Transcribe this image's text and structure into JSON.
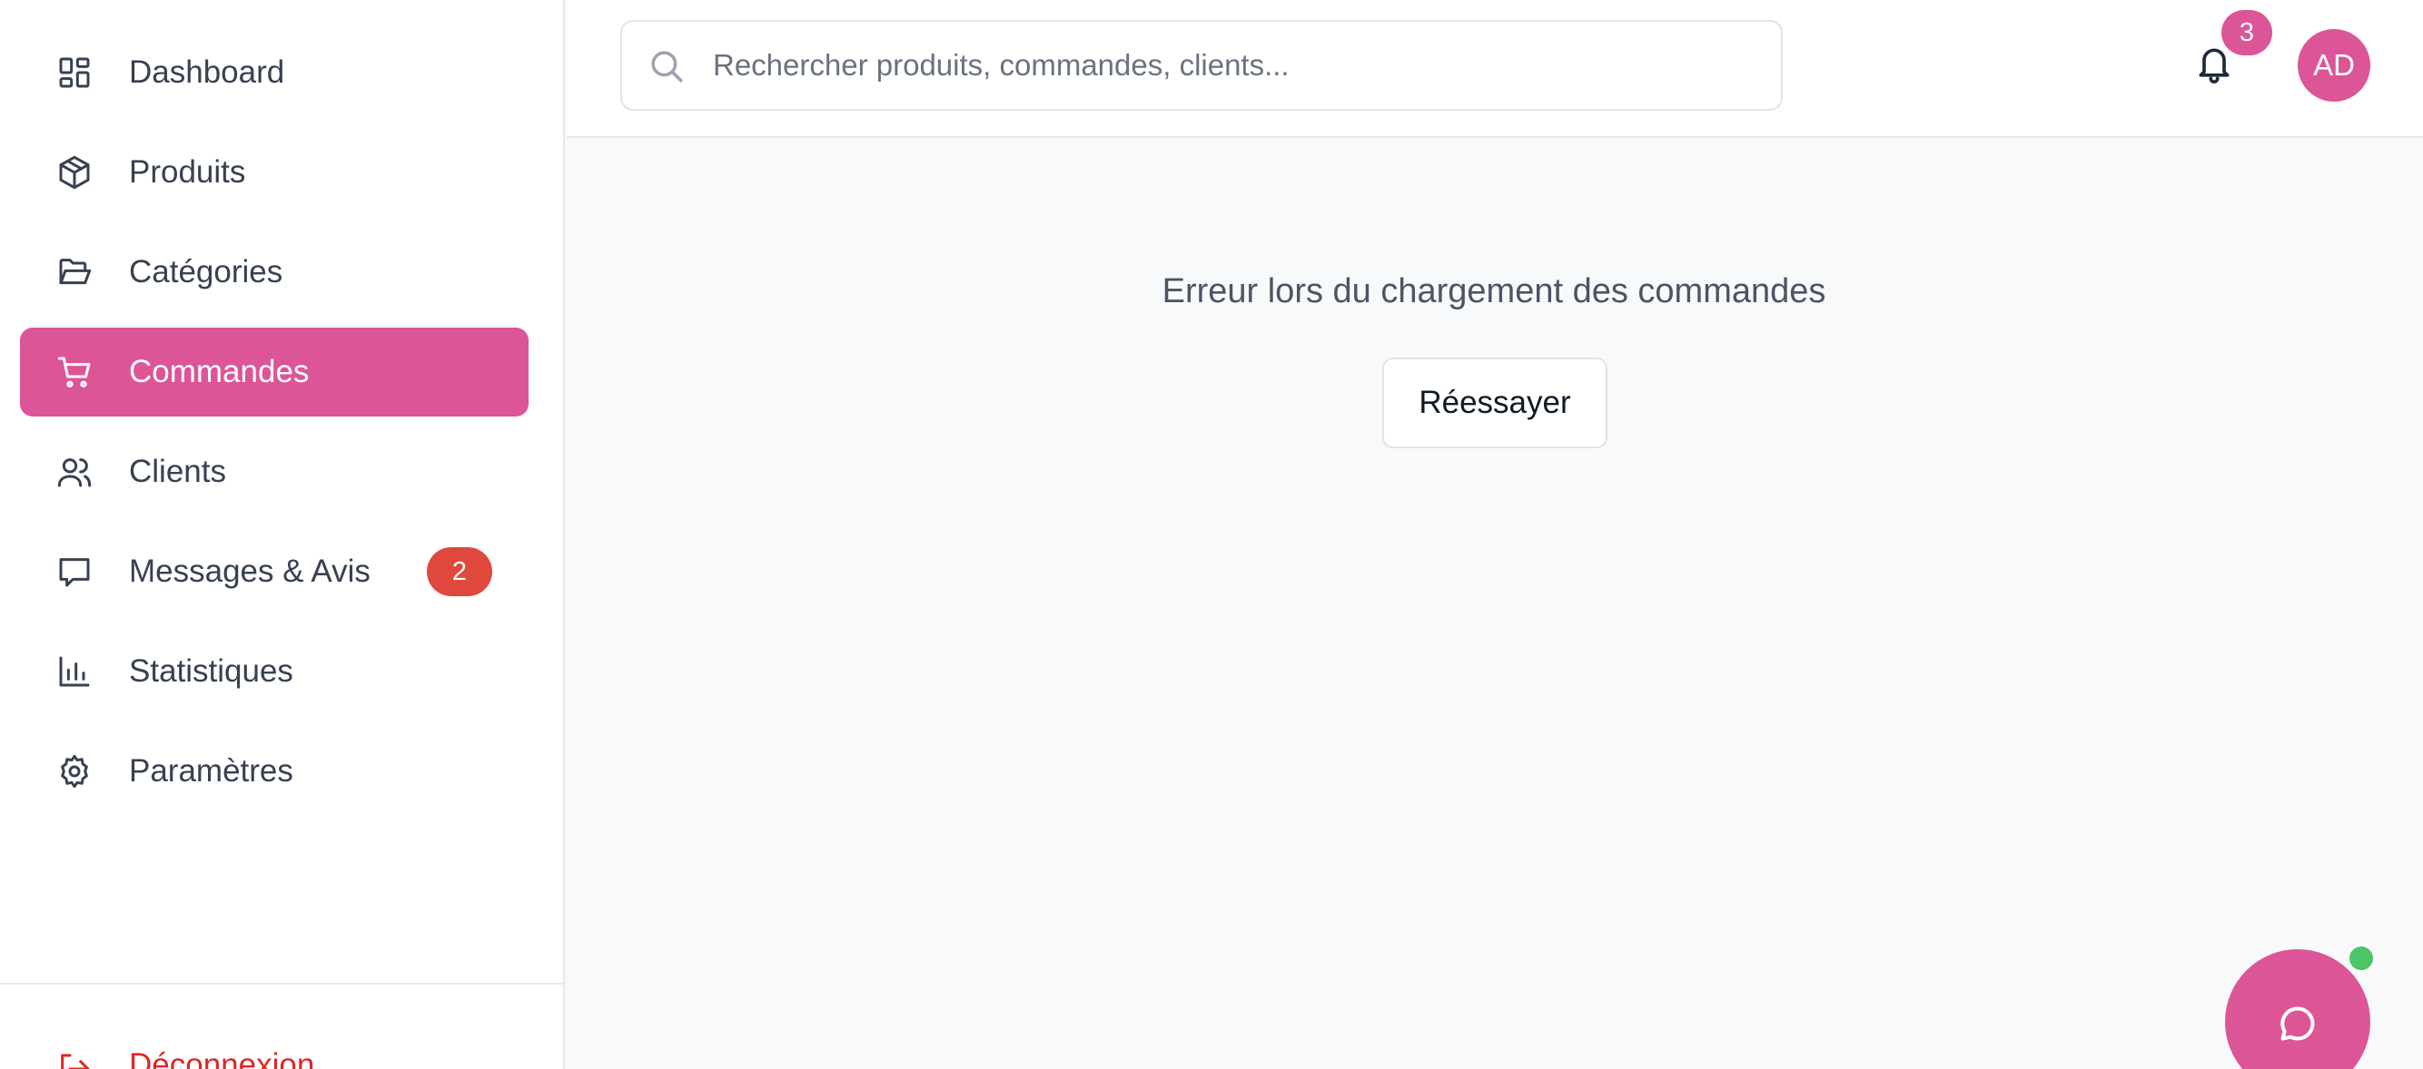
{
  "sidebar": {
    "items": [
      {
        "label": "Dashboard",
        "icon": "dashboard-icon",
        "active": false
      },
      {
        "label": "Produits",
        "icon": "package-icon",
        "active": false
      },
      {
        "label": "Catégories",
        "icon": "folder-icon",
        "active": false
      },
      {
        "label": "Commandes",
        "icon": "cart-icon",
        "active": true
      },
      {
        "label": "Clients",
        "icon": "users-icon",
        "active": false
      },
      {
        "label": "Messages & Avis",
        "icon": "message-icon",
        "active": false,
        "badge": "2"
      },
      {
        "label": "Statistiques",
        "icon": "bar-chart-icon",
        "active": false
      },
      {
        "label": "Paramètres",
        "icon": "settings-icon",
        "active": false
      }
    ],
    "logout_label": "Déconnexion"
  },
  "header": {
    "search_placeholder": "Rechercher produits, commandes, clients...",
    "notification_count": "3",
    "avatar_initials": "AD"
  },
  "main": {
    "error_message": "Erreur lors du chargement des commandes",
    "retry_label": "Réessayer"
  },
  "colors": {
    "accent": "#dc5597",
    "badge_red": "#e0483e",
    "online_green": "#4bc566",
    "logout_red": "#dc2626"
  }
}
